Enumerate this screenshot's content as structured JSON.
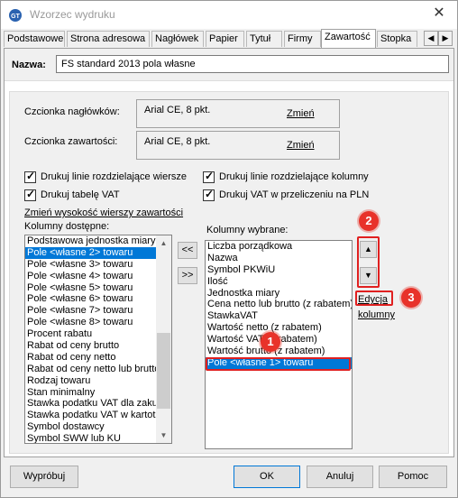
{
  "window": {
    "title": "Wzorzec wydruku",
    "close_glyph": "✕"
  },
  "tabs": [
    {
      "label": "Podstawowe"
    },
    {
      "label": "Strona adresowa"
    },
    {
      "label": "Nagłówek"
    },
    {
      "label": "Papier"
    },
    {
      "label": "Tytuł"
    },
    {
      "label": "Firmy"
    },
    {
      "label": "Zawartość"
    },
    {
      "label": "Stopka"
    }
  ],
  "active_tab": "Zawartość",
  "name_field": {
    "label": "Nazwa:",
    "value": "FS standard 2013 pola własne"
  },
  "fonts": {
    "header_label": "Czcionka nagłówków:",
    "header_value": "Arial CE, 8 pkt.",
    "content_label": "Czcionka zawartości:",
    "content_value": "Arial CE, 8 pkt.",
    "change_link": "Zmień"
  },
  "checkboxes": {
    "row_lines": "Drukuj linie rozdzielające wiersze",
    "col_lines": "Drukuj linie rozdzielające kolumny",
    "vat_table": "Drukuj tabelę VAT",
    "vat_pln": "Drukuj VAT w przeliczeniu na PLN"
  },
  "row_height_link": "Zmień wysokość wierszy zawartości",
  "available": {
    "label": "Kolumny dostępne:",
    "items": [
      "Podstawowa jednostka miary",
      "Pole <własne 2> towaru",
      "Pole <własne 3> towaru",
      "Pole <własne 4> towaru",
      "Pole <własne 5> towaru",
      "Pole <własne 6> towaru",
      "Pole <własne 7> towaru",
      "Pole <własne 8> towaru",
      "Procent rabatu",
      "Rabat od ceny brutto",
      "Rabat od ceny netto",
      "Rabat od ceny netto lub brutto",
      "Rodzaj towaru",
      "Stan minimalny",
      "Stawka podatku VAT dla zakupu",
      "Stawka podatku VAT w kartotece",
      "Symbol dostawcy",
      "Symbol SWW lub KU"
    ],
    "selected": "Pole <własne 2> towaru"
  },
  "move_left": "<<",
  "move_right": ">>",
  "selected_cols": {
    "label": "Kolumny wybrane:",
    "items": [
      "Liczba porządkowa",
      "Nazwa",
      "Symbol PKWiU",
      "Ilość",
      "Jednostka miary",
      "Cena netto lub brutto (z rabatem)",
      "StawkaVAT",
      "Wartość netto (z rabatem)",
      "Wartość VAT (z rabatem)",
      "Wartość brutto (z rabatem)",
      "Pole <własne 1> towaru"
    ],
    "selected": "Pole <własne 1> towaru"
  },
  "edit_link": {
    "line1": "Edycja",
    "line2": "kolumny"
  },
  "badges": [
    "1",
    "2",
    "3"
  ],
  "buttons": {
    "preview": "Wypróbuj",
    "ok": "OK",
    "cancel": "Anuluj",
    "help": "Pomoc"
  },
  "colors": {
    "selection": "#0078d7",
    "annotation": "#e8322a"
  }
}
